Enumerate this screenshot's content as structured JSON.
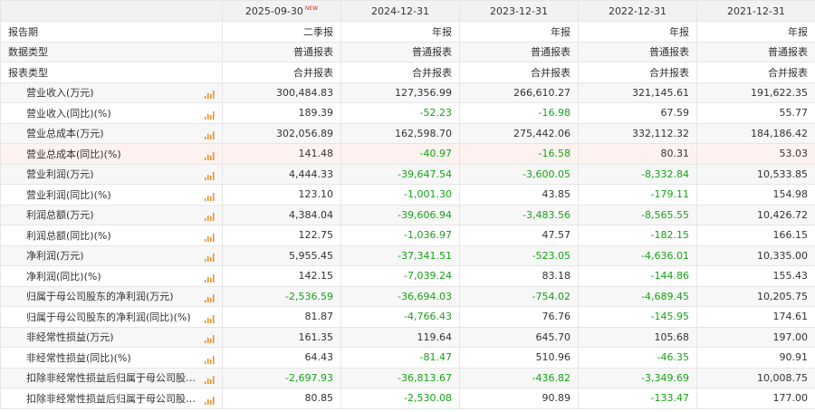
{
  "header": {
    "periods": [
      "2025-09-30",
      "2024-12-31",
      "2023-12-31",
      "2022-12-31",
      "2021-12-31"
    ],
    "new_badge": "NEW"
  },
  "info_rows": [
    {
      "label": "报告期",
      "values": [
        "二季报",
        "年报",
        "年报",
        "年报",
        "年报"
      ]
    },
    {
      "label": "数据类型",
      "values": [
        "普通报表",
        "普通报表",
        "普通报表",
        "普通报表",
        "普通报表"
      ]
    },
    {
      "label": "报表类型",
      "values": [
        "合并报表",
        "合并报表",
        "合并报表",
        "合并报表",
        "合并报表"
      ]
    }
  ],
  "metric_rows": [
    {
      "label": "营业收入(万元)",
      "values": [
        "300,484.83",
        "127,356.99",
        "266,610.27",
        "321,145.61",
        "191,622.35"
      ]
    },
    {
      "label": "营业收入(同比)(%)",
      "values": [
        "189.39",
        "-52.23",
        "-16.98",
        "67.59",
        "55.77"
      ]
    },
    {
      "label": "营业总成本(万元)",
      "values": [
        "302,056.89",
        "162,598.70",
        "275,442.06",
        "332,112.32",
        "184,186.42"
      ]
    },
    {
      "label": "营业总成本(同比)(%)",
      "values": [
        "141.48",
        "-40.97",
        "-16.58",
        "80.31",
        "53.03"
      ]
    },
    {
      "label": "营业利润(万元)",
      "values": [
        "4,444.33",
        "-39,647.54",
        "-3,600.05",
        "-8,332.84",
        "10,533.85"
      ]
    },
    {
      "label": "营业利润(同比)(%)",
      "values": [
        "123.10",
        "-1,001.30",
        "43.85",
        "-179.11",
        "154.98"
      ]
    },
    {
      "label": "利润总额(万元)",
      "values": [
        "4,384.04",
        "-39,606.94",
        "-3,483.56",
        "-8,565.55",
        "10,426.72"
      ]
    },
    {
      "label": "利润总额(同比)(%)",
      "values": [
        "122.75",
        "-1,036.97",
        "47.57",
        "-182.15",
        "166.15"
      ]
    },
    {
      "label": "净利润(万元)",
      "values": [
        "5,955.45",
        "-37,341.51",
        "-523.05",
        "-4,636.01",
        "10,335.00"
      ]
    },
    {
      "label": "净利润(同比)(%)",
      "values": [
        "142.15",
        "-7,039.24",
        "83.18",
        "-144.86",
        "155.43"
      ]
    },
    {
      "label": "归属于母公司股东的净利润(万元)",
      "values": [
        "-2,536.59",
        "-36,694.03",
        "-754.02",
        "-4,689.45",
        "10,205.75"
      ]
    },
    {
      "label": "归属于母公司股东的净利润(同比)(%)",
      "values": [
        "81.87",
        "-4,766.43",
        "76.76",
        "-145.95",
        "174.61"
      ]
    },
    {
      "label": "非经常性损益(万元)",
      "values": [
        "161.35",
        "119.64",
        "645.70",
        "105.68",
        "197.00"
      ]
    },
    {
      "label": "非经常性损益(同比)(%)",
      "values": [
        "64.43",
        "-81.47",
        "510.96",
        "-46.35",
        "90.91"
      ]
    },
    {
      "label": "扣除非经常性损益后归属于母公司股东...",
      "values": [
        "-2,697.93",
        "-36,813.67",
        "-436.82",
        "-3,349.69",
        "10,008.75"
      ]
    },
    {
      "label": "扣除非经常性损益后归属于母公司股东...",
      "values": [
        "80.85",
        "-2,530.08",
        "90.89",
        "-133.47",
        "177.00"
      ]
    }
  ],
  "highlight_row_index": 3,
  "icon": "bar-chart-icon",
  "colors": {
    "negative": "#16a316",
    "icon": "#f08a1f",
    "header_bg": "#f2f2f2",
    "highlight": "#fdf2f0",
    "new_badge": "#e0301e"
  }
}
